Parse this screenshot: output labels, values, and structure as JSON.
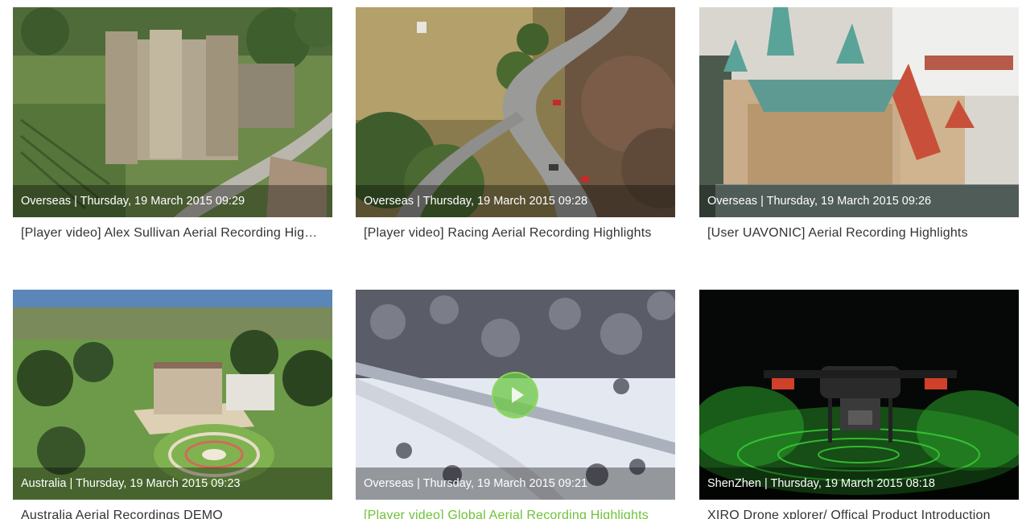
{
  "videos": [
    {
      "location": "Overseas",
      "date": "Thursday, 19 March 2015 09:29",
      "meta": "Overseas | Thursday, 19 March 2015 09:29",
      "title": "[Player video] Alex Sullivan Aerial Recording Highlights",
      "thumbnail_icon": "castle-aerial-thumbnail"
    },
    {
      "location": "Overseas",
      "date": "Thursday, 19 March 2015 09:28",
      "meta": "Overseas | Thursday, 19 March 2015 09:28",
      "title": "[Player video] Racing Aerial Recording Highlights",
      "thumbnail_icon": "mountain-road-thumbnail"
    },
    {
      "location": "Overseas",
      "date": "Thursday, 19 March 2015 09:26",
      "meta": "Overseas | Thursday, 19 March 2015 09:26",
      "title": "[User UAVONIC] Aerial Recording Highlights",
      "thumbnail_icon": "snow-castle-thumbnail"
    },
    {
      "location": "Australia",
      "date": "Thursday, 19 March 2015 09:23",
      "meta": "Australia | Thursday, 19 March 2015 09:23",
      "title": "Australia Aerial Recordings DEMO",
      "thumbnail_icon": "estate-garden-thumbnail"
    },
    {
      "location": "Overseas",
      "date": "Thursday, 19 March 2015 09:21",
      "meta": "Overseas | Thursday, 19 March 2015 09:21",
      "title": "[Player video] Global Aerial Recording Highlights",
      "thumbnail_icon": "snowy-forest-road-thumbnail",
      "hovered": true
    },
    {
      "location": "ShenZhen",
      "date": "Thursday, 19 March 2015 08:18",
      "meta": "ShenZhen | Thursday, 19 March 2015 08:18",
      "title": "XIRO Drone xplorer/ Offical Product Introduction",
      "thumbnail_icon": "drone-product-thumbnail"
    }
  ],
  "colors": {
    "accent_green": "#6fc23a",
    "caption_text": "#333333",
    "overlay_text": "#ffffff"
  }
}
